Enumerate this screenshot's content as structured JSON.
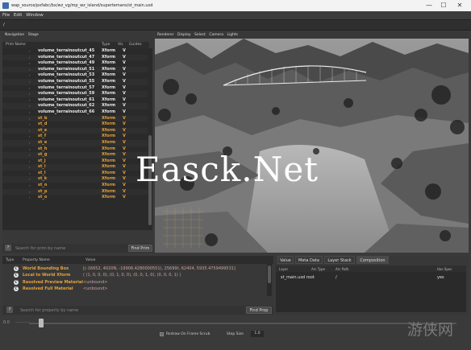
{
  "window": {
    "title": "wap_source/pxfabc/bx/wz_vg/mp_wz_island/supertemans/st_main.usd",
    "minimize_glyph": "—",
    "maximize_glyph": "☐",
    "close_glyph": "✕"
  },
  "menu": {
    "file": "File",
    "edit": "Edit",
    "window": "Window"
  },
  "path": {
    "value": "/"
  },
  "left_tabs": {
    "navigation": "Navigation",
    "stage": "Stage"
  },
  "tree": {
    "columns": {
      "prim_name": "Prim Name",
      "type": "Type",
      "vis": "Vis",
      "guides": "Guides"
    },
    "rows": [
      {
        "name": "volume_terrainoutcut_45",
        "type": "Xform",
        "vis": "V",
        "color": "white"
      },
      {
        "name": "volume_terrainoutcut_47",
        "type": "Xform",
        "vis": "V",
        "color": "white"
      },
      {
        "name": "volume_terrainoutcut_49",
        "type": "Xform",
        "vis": "V",
        "color": "white"
      },
      {
        "name": "volume_terrainoutcut_51",
        "type": "Xform",
        "vis": "V",
        "color": "white"
      },
      {
        "name": "volume_terrainoutcut_53",
        "type": "Xform",
        "vis": "V",
        "color": "white"
      },
      {
        "name": "volume_terrainoutcut_55",
        "type": "Xform",
        "vis": "V",
        "color": "white"
      },
      {
        "name": "volume_terrainoutcut_57",
        "type": "Xform",
        "vis": "V",
        "color": "white"
      },
      {
        "name": "volume_terrainoutcut_59",
        "type": "Xform",
        "vis": "V",
        "color": "white"
      },
      {
        "name": "volume_terrainoutcut_61",
        "type": "Xform",
        "vis": "V",
        "color": "white"
      },
      {
        "name": "volume_terrainoutcut_62",
        "type": "Xform",
        "vis": "V",
        "color": "white"
      },
      {
        "name": "volume_terrainoutcut_66",
        "type": "Xform",
        "vis": "V",
        "color": "white"
      },
      {
        "name": "st_b",
        "type": "Xform",
        "vis": "V",
        "color": "orange"
      },
      {
        "name": "st_d",
        "type": "Xform",
        "vis": "V",
        "color": "orange"
      },
      {
        "name": "st_e",
        "type": "Xform",
        "vis": "V",
        "color": "orange"
      },
      {
        "name": "st_f",
        "type": "Xform",
        "vis": "V",
        "color": "orange"
      },
      {
        "name": "st_e",
        "type": "Xform",
        "vis": "V",
        "color": "orange"
      },
      {
        "name": "st_h",
        "type": "Xform",
        "vis": "V",
        "color": "orange"
      },
      {
        "name": "st_g",
        "type": "Xform",
        "vis": "V",
        "color": "orange"
      },
      {
        "name": "st_j",
        "type": "Xform",
        "vis": "V",
        "color": "orange"
      },
      {
        "name": "st_i",
        "type": "Xform",
        "vis": "V",
        "color": "orange"
      },
      {
        "name": "st_l",
        "type": "Xform",
        "vis": "V",
        "color": "orange"
      },
      {
        "name": "st_k",
        "type": "Xform",
        "vis": "V",
        "color": "orange"
      },
      {
        "name": "st_n",
        "type": "Xform",
        "vis": "V",
        "color": "orange"
      },
      {
        "name": "st_p",
        "type": "Xform",
        "vis": "V",
        "color": "orange"
      },
      {
        "name": "st_o",
        "type": "Xform",
        "vis": "V",
        "color": "orange"
      }
    ],
    "search_placeholder": "Search for prim by name",
    "find_button": "Find Prim",
    "help_glyph": "?"
  },
  "viewport_menu": {
    "renderer": "Renderer",
    "display": "Display",
    "select": "Select",
    "camera": "Camera",
    "lights": "Lights"
  },
  "properties": {
    "columns": {
      "type": "Type",
      "name": "Property Name",
      "value": "Value"
    },
    "rows": [
      {
        "icon": "C",
        "name": "World Bounding Box",
        "value": "[(-16652, 4020N, -19906.4280000551), 25699t, 62404, 5935.4759499531]"
      },
      {
        "icon": "C",
        "name": "Local to World Xform",
        "value": "( (1, 0, 0, 0), (0, 1, 0, 0), (0, 0, 1, 0), (0, 0, 0, 1) )"
      },
      {
        "icon": "C",
        "name": "Resolved Preview Material",
        "value": "<unbound>"
      },
      {
        "icon": "C",
        "name": "Resolved Full Material",
        "value": "<unbound>"
      }
    ],
    "search_placeholder": "Search for property by name",
    "find_button": "Find Prop",
    "help_glyph": "?"
  },
  "right_tabs": {
    "value": "Value",
    "meta_data": "Meta Data",
    "layer_stack": "Layer Stack",
    "composition": "Composition"
  },
  "composition": {
    "columns": {
      "layer": "Layer",
      "arc_type": "Arc Type",
      "arc_path": "Arc Path",
      "has_spec": "Has Spec"
    },
    "row": {
      "layer": "st_main.usd root",
      "arc_type": "",
      "arc_path": "/",
      "has_spec": "yes"
    }
  },
  "timeline": {
    "frame_label": "0.0",
    "range_label": "----------",
    "redraw_label": "Redraw On Frame Scrub",
    "step_label": "Step Size",
    "step_value": "1.0"
  },
  "watermark": {
    "text": "Easck.Net",
    "logo_text": "游侠网"
  }
}
